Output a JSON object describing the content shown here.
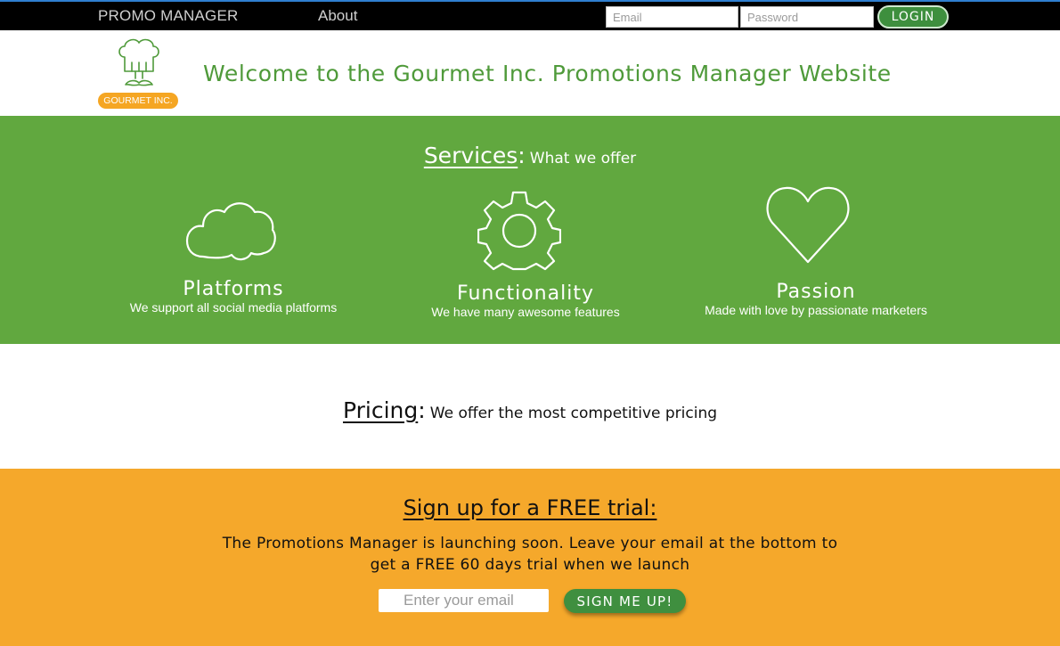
{
  "nav": {
    "brand": "PROMO MANAGER",
    "about": "About",
    "email_placeholder": "Email",
    "password_placeholder": "Password",
    "login": "LOGIN"
  },
  "header": {
    "logo_text": "GOURMET INC.",
    "welcome": "Welcome to the Gourmet Inc. Promotions Manager Website"
  },
  "services": {
    "title": "Services",
    "colon": ":",
    "subtitle": "What we offer",
    "items": [
      {
        "icon": "cloud-icon",
        "title": "Platforms",
        "desc": "We support all social media platforms"
      },
      {
        "icon": "gear-icon",
        "title": "Functionality",
        "desc": "We have many awesome features"
      },
      {
        "icon": "heart-icon",
        "title": "Passion",
        "desc": "Made with love by passionate marketers"
      }
    ]
  },
  "pricing": {
    "title": "Pricing",
    "colon": ":",
    "subtitle": "We offer the most competitive pricing"
  },
  "signup": {
    "title": "Sign up for a FREE trial:",
    "text_line1": "The Promotions Manager is launching soon. Leave your email at the bottom to",
    "text_line2": "get a FREE 60 days trial when we launch",
    "email_placeholder": "Enter your email",
    "button": "SIGN ME UP!"
  },
  "colors": {
    "nav_bg": "#000000",
    "accent_green": "#61a83f",
    "dark_green": "#3e8f3e",
    "orange": "#f5a82b",
    "welcome_text": "#4f9a3a"
  }
}
